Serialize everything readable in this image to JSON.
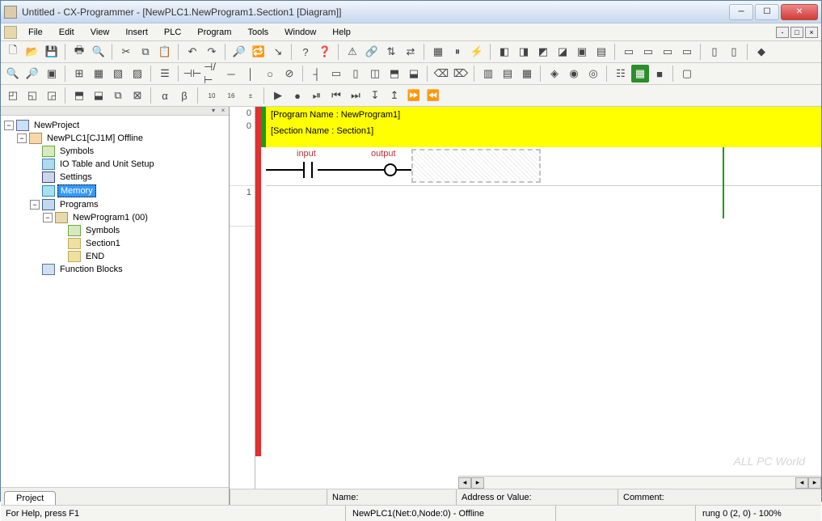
{
  "window": {
    "title": "Untitled - CX-Programmer - [NewPLC1.NewProgram1.Section1 [Diagram]]"
  },
  "menus": [
    "File",
    "Edit",
    "View",
    "Insert",
    "PLC",
    "Program",
    "Tools",
    "Window",
    "Help"
  ],
  "tree": {
    "root": "NewProject",
    "plc": "NewPLC1[CJ1M] Offline",
    "symbols": "Symbols",
    "io": "IO Table and Unit Setup",
    "settings": "Settings",
    "memory": "Memory",
    "programs": "Programs",
    "program1": "NewProgram1 (00)",
    "prog_symbols": "Symbols",
    "section1": "Section1",
    "end": "END",
    "fb": "Function Blocks"
  },
  "sidebar_tab": "Project",
  "rung": {
    "program_header": "[Program Name : NewProgram1]",
    "section_header": "[Section Name : Section1]",
    "input_label": "input",
    "output_label": "output",
    "row0": "0",
    "row0b": "0",
    "row1": "1"
  },
  "infobar": {
    "name_label": "Name:",
    "name_value": "",
    "addr_label": "Address or Value:",
    "addr_value": "",
    "comment_label": "Comment:",
    "comment_value": ""
  },
  "status": {
    "help": "For Help, press F1",
    "plc": "NewPLC1(Net:0,Node:0) - Offline",
    "rung": "rung 0 (2, 0)  - 100%"
  },
  "watermark": "ALL PC World"
}
